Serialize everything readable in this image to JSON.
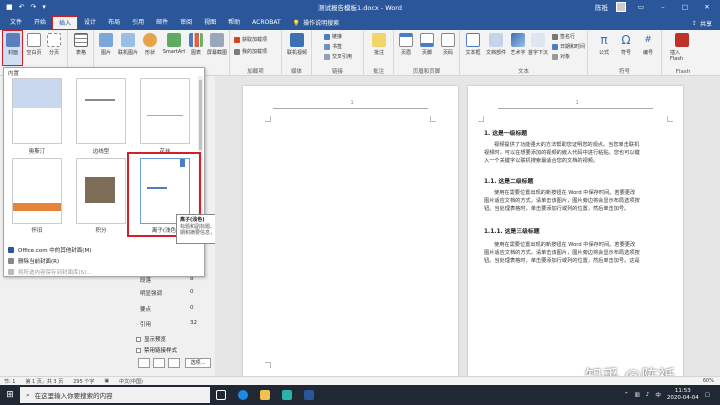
{
  "window": {
    "title": "测试报告模板1.docx - Word",
    "user": "陈祗",
    "qat": [
      "↶",
      "↷",
      "▾"
    ]
  },
  "tabs": [
    "文件",
    "开始",
    "插入",
    "设计",
    "布局",
    "引用",
    "邮件",
    "审阅",
    "视图",
    "帮助",
    "ACROBAT"
  ],
  "tell_me": "操作说明搜索",
  "share_label": "共享",
  "ribbon": {
    "pages": {
      "cover": "封面",
      "blank": "空白页",
      "break": "分页"
    },
    "table": "表格",
    "illustrations": [
      "图片",
      "联机图片",
      "形状",
      "SmartArt",
      "图表",
      "屏幕截图"
    ],
    "addins": {
      "get": "获取加载项",
      "my": "我的加载项",
      "label": "加载项"
    },
    "media": {
      "video": "联机视频",
      "label": "媒体"
    },
    "links": {
      "link": "链接",
      "bookmark": "书签",
      "xref": "交叉引用",
      "label": "链接"
    },
    "comments": {
      "comment": "批注",
      "label": "批注"
    },
    "header_footer": {
      "header": "页眉",
      "footer": "页脚",
      "page_number": "页码",
      "label": "页眉和页脚"
    },
    "text": {
      "textbox": "文本框",
      "parts": "文档部件",
      "wordart": "艺术字",
      "dropcap": "首字下沉",
      "signature": "签名行",
      "datetime": "日期和时间",
      "object": "对象",
      "label": "文本"
    },
    "symbols": {
      "equation": "公式",
      "symbol": "符号",
      "number": "编号",
      "label": "符号"
    },
    "flash": {
      "insert": "插入 Flash",
      "label": "Flash"
    }
  },
  "gallery": {
    "title": "内置",
    "covers": [
      {
        "label": "奥斯汀",
        "active": false
      },
      {
        "label": "边线型",
        "active": false
      },
      {
        "label": "花丝",
        "active": false
      },
      {
        "label": "怀旧",
        "active": false
      },
      {
        "label": "积分",
        "active": false
      },
      {
        "label": "离子(浅色)",
        "active": true
      }
    ],
    "menu": [
      {
        "label": "Office.com 中的其他封面(M)",
        "disabled": false
      },
      {
        "label": "删除当前封面(R)",
        "disabled": false
      },
      {
        "label": "将所选内容保存到封面库(S)...",
        "disabled": true
      }
    ]
  },
  "tooltip": {
    "title": "离子(浅色)",
    "body": "标题和副标题、作者、日期和摘要信息，具有"
  },
  "stats": [
    {
      "label": "段落",
      "value": "8"
    },
    {
      "label": "明显强调",
      "value": "0"
    },
    {
      "label": "要点",
      "value": "0"
    },
    {
      "label": "引用",
      "value": "32"
    }
  ],
  "pane_options": [
    {
      "label": "显示预览"
    },
    {
      "label": "禁用链接样式"
    }
  ],
  "options_button": "选项...",
  "document": {
    "page1_number": "1",
    "page2_number": "1",
    "heading1": "1. 这是一级标题",
    "para1": [
      "视频提供了功能强大的方法帮助您证明您的观点。当您单击联机",
      "视频时，可以在想要添加的视频的嵌入代码中进行粘贴。您也可以键",
      "入一个关键字以联机搜索最适合您的文档的视频。"
    ],
    "heading2": "1.1. 这是二级标题",
    "para2": [
      "使用在需要位置出现的新按钮在 Word 中保存时间。若要更改",
      "图片适应文档的方式，请单击该图片，图片旁边将会显示布局选项按",
      "钮。当处理表格时，单击要添加行或列的位置，然后单击加号。"
    ],
    "heading3": "1.1.1. 这是三级标题",
    "para3": [
      "使用在需要位置出现的新按钮在 Word 中保存时间。若要更改",
      "图片适应文档的方式，请单击该图片，图片旁边将会显示布局选项按",
      "钮。当处理表格时，单击要添加行或列的位置，然后单击加号。这是"
    ]
  },
  "watermark": "知乎 @陈祗",
  "status": {
    "section": "节: 1",
    "page": "第 1 页，共 3 页",
    "words": "295 个字",
    "language": "中文(中国)",
    "zoom": "60%"
  },
  "taskbar": {
    "search_placeholder": "在这里输入你要搜索的内容",
    "time": "11:53",
    "date": "2020-04-04",
    "ime": "中"
  },
  "colors": {
    "word_blue": "#2b579a",
    "highlight_red": "#d21f2c"
  }
}
